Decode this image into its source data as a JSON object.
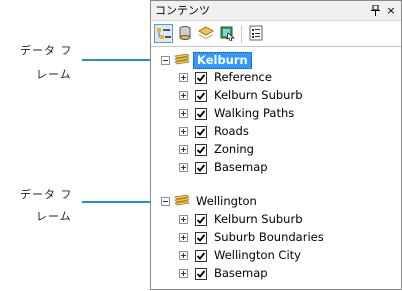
{
  "callouts": [
    {
      "line1": "データ フ",
      "line2": "レーム"
    },
    {
      "line1": "データ フ",
      "line2": "レーム"
    }
  ],
  "panel": {
    "title": "コンテンツ",
    "pin_glyph": "ₕ",
    "close_glyph": "×"
  },
  "toolbar": {
    "tools": [
      {
        "name": "list-by-drawing-order-icon",
        "active": true
      },
      {
        "name": "list-by-source-icon",
        "active": false
      },
      {
        "name": "list-by-visibility-icon",
        "active": false
      },
      {
        "name": "list-by-selection-icon",
        "active": false
      },
      {
        "name": "options-icon",
        "active": false
      }
    ]
  },
  "data_frames": [
    {
      "name": "Kelburn",
      "active": true,
      "layers": [
        {
          "label": "Reference",
          "checked": true
        },
        {
          "label": "Kelburn Suburb",
          "checked": true
        },
        {
          "label": "Walking Paths",
          "checked": true
        },
        {
          "label": "Roads",
          "checked": true
        },
        {
          "label": "Zoning",
          "checked": true
        },
        {
          "label": "Basemap",
          "checked": true
        }
      ]
    },
    {
      "name": "Wellington",
      "active": false,
      "layers": [
        {
          "label": "Kelburn Suburb",
          "checked": true
        },
        {
          "label": "Suburb Boundaries",
          "checked": true
        },
        {
          "label": "Wellington City",
          "checked": true
        },
        {
          "label": "Basemap",
          "checked": true
        }
      ]
    }
  ],
  "colors": {
    "accent": "#3399ff",
    "callout_line": "#1a8fdc"
  }
}
